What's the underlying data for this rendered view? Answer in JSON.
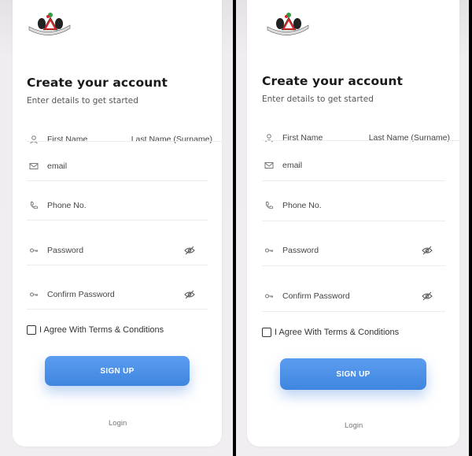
{
  "form": {
    "title": "Create your account",
    "subtitle": "Enter details to get started",
    "first_name_placeholder": "First Name",
    "last_name_placeholder": "Last Name (Surname)",
    "email_placeholder": "email",
    "phone_placeholder": "Phone No.",
    "password_placeholder": "Password",
    "confirm_password_placeholder": "Confirm Password",
    "terms_label": "I Agree With Terms & Conditions",
    "terms_checked": false,
    "signup_label": "SIGN UP",
    "login_label": "Login"
  },
  "icons": {
    "name": "user-icon",
    "email": "mail-icon",
    "phone": "phone-icon",
    "password": "key-icon",
    "visibility": "eye-off-icon",
    "logo": "coat-of-arms-logo"
  },
  "colors": {
    "accent": "#4a90e2",
    "title": "#1a1a1a",
    "muted": "#777777"
  }
}
